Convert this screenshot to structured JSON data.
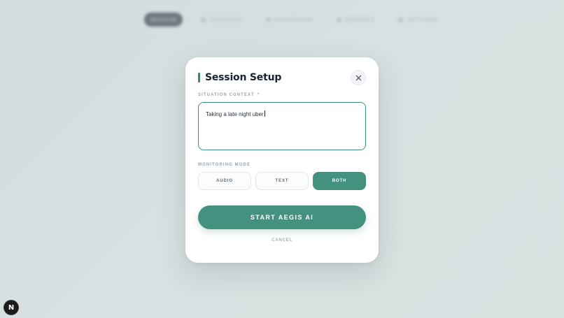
{
  "background_nav": {
    "items": [
      {
        "label": "SESSION",
        "active": true
      },
      {
        "label": "OVERVIEW",
        "active": false
      },
      {
        "label": "DASHBOARD",
        "active": false
      },
      {
        "label": "REPORTS",
        "active": false
      },
      {
        "label": "SETTINGS",
        "active": false
      }
    ]
  },
  "modal": {
    "title": "Session Setup",
    "close_icon": "close-icon",
    "context": {
      "label": "SITUATION CONTEXT",
      "required_marker": "*",
      "value": "Taking a late night uber"
    },
    "mode": {
      "label": "MONITORING MODE",
      "options": [
        "AUDIO",
        "TEXT",
        "BOTH"
      ],
      "selected": "BOTH"
    },
    "start_label": "START AEGIS AI",
    "cancel_label": "CANCEL"
  },
  "badge": {
    "label": "N"
  },
  "colors": {
    "accent": "#45917f",
    "title_bar": "#2f8a7a",
    "title_text": "#1a2230"
  }
}
